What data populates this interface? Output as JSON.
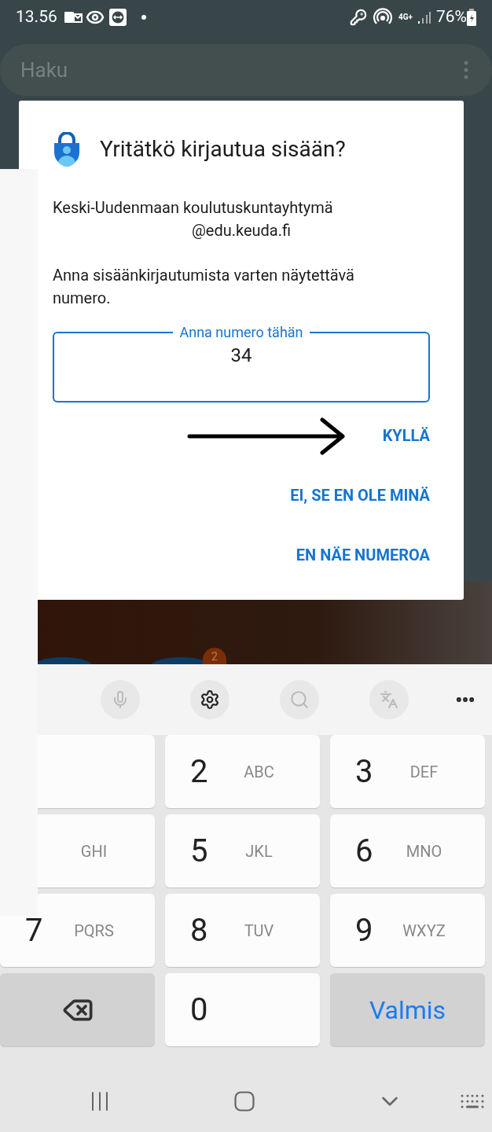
{
  "status_bar": {
    "time": "13.56",
    "network": "4G+",
    "battery": "76%"
  },
  "search": {
    "placeholder": "Haku"
  },
  "home": {
    "badge": "2"
  },
  "dialog": {
    "title": "Yritätkö kirjautua sisään?",
    "account": [
      "Keski-Uudenmaan koulutuskuntayhtymä",
      "@edu.keuda.fi"
    ],
    "instruction": "Anna sisäänkirjautumista varten näytettävä numero.",
    "field": {
      "label": "Anna numero tähän",
      "value": "34",
      "focused": true
    },
    "actions": [
      "KYLLÄ",
      "EI, SE EN OLE MINÄ",
      "EN NÄE NUMEROA"
    ]
  },
  "keyboard": {
    "keys": [
      {
        "kind": "digit"
      },
      {
        "kind": "digit",
        "digit": "2",
        "letters": "ABC"
      },
      {
        "kind": "digit",
        "digit": "3",
        "letters": "DEF"
      },
      {
        "kind": "digit",
        "letters": "GHI"
      },
      {
        "kind": "digit",
        "digit": "5",
        "letters": "JKL"
      },
      {
        "kind": "digit",
        "digit": "6",
        "letters": "MNO"
      },
      {
        "kind": "digit",
        "digit": "7",
        "letters": "PQRS"
      },
      {
        "kind": "digit",
        "digit": "8",
        "letters": "TUV"
      },
      {
        "kind": "digit",
        "digit": "9",
        "letters": "WXYZ"
      },
      {
        "kind": "backspace"
      },
      {
        "kind": "digit",
        "digit": "0"
      },
      {
        "kind": "action",
        "label": "Valmis"
      }
    ]
  }
}
